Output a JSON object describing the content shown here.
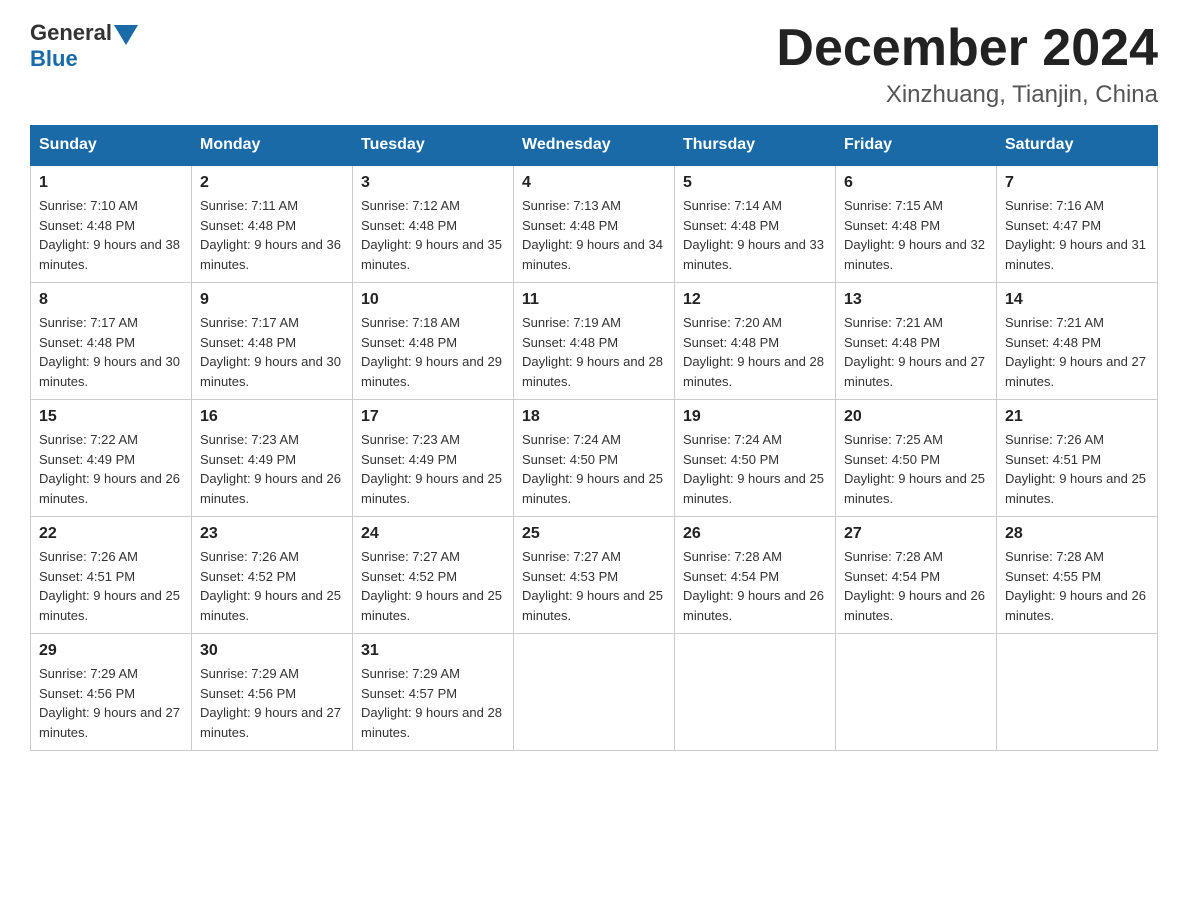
{
  "header": {
    "logo_general": "General",
    "logo_blue": "Blue",
    "month_title": "December 2024",
    "location": "Xinzhuang, Tianjin, China"
  },
  "weekdays": [
    "Sunday",
    "Monday",
    "Tuesday",
    "Wednesday",
    "Thursday",
    "Friday",
    "Saturday"
  ],
  "weeks": [
    [
      {
        "day": "1",
        "sunrise": "7:10 AM",
        "sunset": "4:48 PM",
        "daylight": "9 hours and 38 minutes."
      },
      {
        "day": "2",
        "sunrise": "7:11 AM",
        "sunset": "4:48 PM",
        "daylight": "9 hours and 36 minutes."
      },
      {
        "day": "3",
        "sunrise": "7:12 AM",
        "sunset": "4:48 PM",
        "daylight": "9 hours and 35 minutes."
      },
      {
        "day": "4",
        "sunrise": "7:13 AM",
        "sunset": "4:48 PM",
        "daylight": "9 hours and 34 minutes."
      },
      {
        "day": "5",
        "sunrise": "7:14 AM",
        "sunset": "4:48 PM",
        "daylight": "9 hours and 33 minutes."
      },
      {
        "day": "6",
        "sunrise": "7:15 AM",
        "sunset": "4:48 PM",
        "daylight": "9 hours and 32 minutes."
      },
      {
        "day": "7",
        "sunrise": "7:16 AM",
        "sunset": "4:47 PM",
        "daylight": "9 hours and 31 minutes."
      }
    ],
    [
      {
        "day": "8",
        "sunrise": "7:17 AM",
        "sunset": "4:48 PM",
        "daylight": "9 hours and 30 minutes."
      },
      {
        "day": "9",
        "sunrise": "7:17 AM",
        "sunset": "4:48 PM",
        "daylight": "9 hours and 30 minutes."
      },
      {
        "day": "10",
        "sunrise": "7:18 AM",
        "sunset": "4:48 PM",
        "daylight": "9 hours and 29 minutes."
      },
      {
        "day": "11",
        "sunrise": "7:19 AM",
        "sunset": "4:48 PM",
        "daylight": "9 hours and 28 minutes."
      },
      {
        "day": "12",
        "sunrise": "7:20 AM",
        "sunset": "4:48 PM",
        "daylight": "9 hours and 28 minutes."
      },
      {
        "day": "13",
        "sunrise": "7:21 AM",
        "sunset": "4:48 PM",
        "daylight": "9 hours and 27 minutes."
      },
      {
        "day": "14",
        "sunrise": "7:21 AM",
        "sunset": "4:48 PM",
        "daylight": "9 hours and 27 minutes."
      }
    ],
    [
      {
        "day": "15",
        "sunrise": "7:22 AM",
        "sunset": "4:49 PM",
        "daylight": "9 hours and 26 minutes."
      },
      {
        "day": "16",
        "sunrise": "7:23 AM",
        "sunset": "4:49 PM",
        "daylight": "9 hours and 26 minutes."
      },
      {
        "day": "17",
        "sunrise": "7:23 AM",
        "sunset": "4:49 PM",
        "daylight": "9 hours and 25 minutes."
      },
      {
        "day": "18",
        "sunrise": "7:24 AM",
        "sunset": "4:50 PM",
        "daylight": "9 hours and 25 minutes."
      },
      {
        "day": "19",
        "sunrise": "7:24 AM",
        "sunset": "4:50 PM",
        "daylight": "9 hours and 25 minutes."
      },
      {
        "day": "20",
        "sunrise": "7:25 AM",
        "sunset": "4:50 PM",
        "daylight": "9 hours and 25 minutes."
      },
      {
        "day": "21",
        "sunrise": "7:26 AM",
        "sunset": "4:51 PM",
        "daylight": "9 hours and 25 minutes."
      }
    ],
    [
      {
        "day": "22",
        "sunrise": "7:26 AM",
        "sunset": "4:51 PM",
        "daylight": "9 hours and 25 minutes."
      },
      {
        "day": "23",
        "sunrise": "7:26 AM",
        "sunset": "4:52 PM",
        "daylight": "9 hours and 25 minutes."
      },
      {
        "day": "24",
        "sunrise": "7:27 AM",
        "sunset": "4:52 PM",
        "daylight": "9 hours and 25 minutes."
      },
      {
        "day": "25",
        "sunrise": "7:27 AM",
        "sunset": "4:53 PM",
        "daylight": "9 hours and 25 minutes."
      },
      {
        "day": "26",
        "sunrise": "7:28 AM",
        "sunset": "4:54 PM",
        "daylight": "9 hours and 26 minutes."
      },
      {
        "day": "27",
        "sunrise": "7:28 AM",
        "sunset": "4:54 PM",
        "daylight": "9 hours and 26 minutes."
      },
      {
        "day": "28",
        "sunrise": "7:28 AM",
        "sunset": "4:55 PM",
        "daylight": "9 hours and 26 minutes."
      }
    ],
    [
      {
        "day": "29",
        "sunrise": "7:29 AM",
        "sunset": "4:56 PM",
        "daylight": "9 hours and 27 minutes."
      },
      {
        "day": "30",
        "sunrise": "7:29 AM",
        "sunset": "4:56 PM",
        "daylight": "9 hours and 27 minutes."
      },
      {
        "day": "31",
        "sunrise": "7:29 AM",
        "sunset": "4:57 PM",
        "daylight": "9 hours and 28 minutes."
      },
      null,
      null,
      null,
      null
    ]
  ],
  "labels": {
    "sunrise_prefix": "Sunrise: ",
    "sunset_prefix": "Sunset: ",
    "daylight_prefix": "Daylight: "
  }
}
